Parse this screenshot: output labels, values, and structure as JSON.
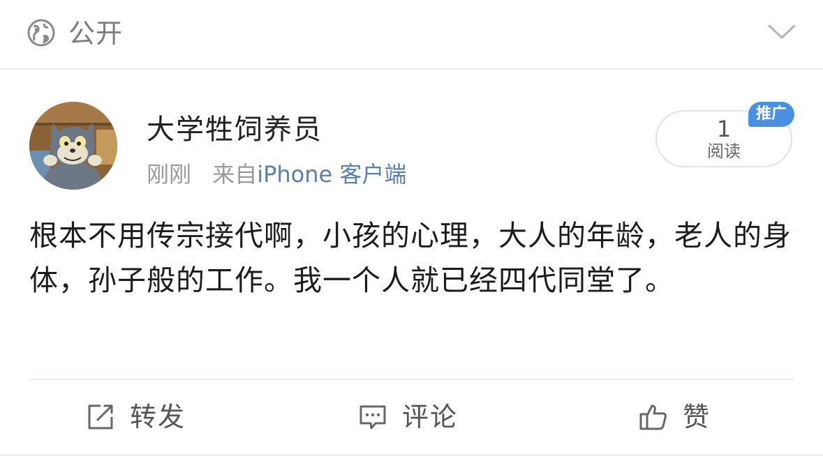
{
  "visibility": {
    "icon": "globe-icon",
    "label": "公开",
    "expand_icon": "chevron-down-icon"
  },
  "post": {
    "author": {
      "avatar_icon": "avatar",
      "name": "大学牲饲养员"
    },
    "time": "刚刚",
    "source_prefix": "来自",
    "source": "iPhone 客户端",
    "read_count": "1",
    "read_label": "阅读",
    "badge": "推广",
    "text": "根本不用传宗接代啊，小孩的心理，大人的年龄，老人的身体，孙子般的工作。我一个人就已经四代同堂了。"
  },
  "actions": {
    "repost": {
      "icon": "repost-icon",
      "label": "转发"
    },
    "comment": {
      "icon": "comment-icon",
      "label": "评论"
    },
    "like": {
      "icon": "thumbs-up-icon",
      "label": "赞"
    }
  },
  "colors": {
    "link": "#5b7fa8",
    "badge": "#4a8fe0",
    "muted": "#9a9a9a"
  }
}
